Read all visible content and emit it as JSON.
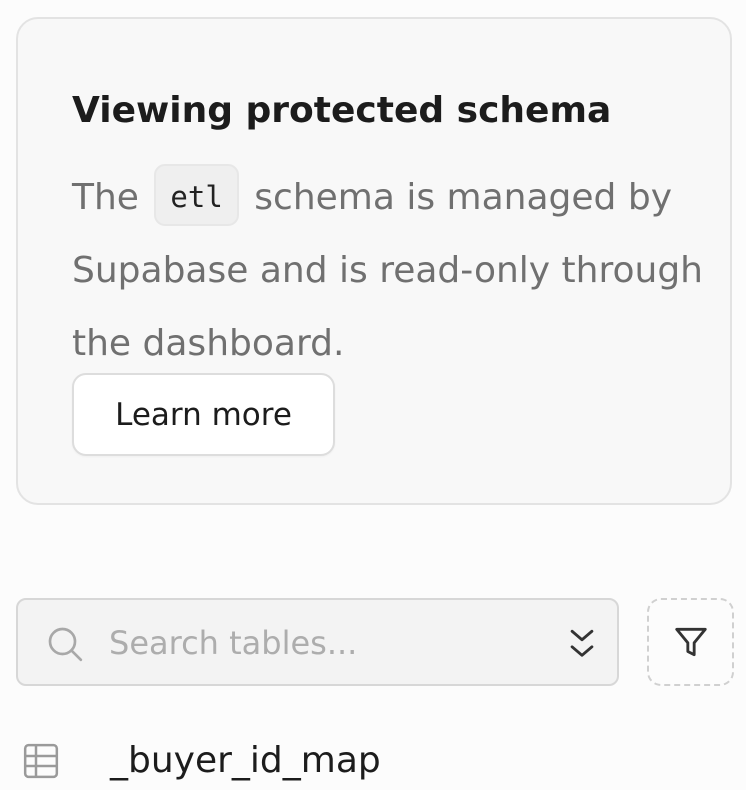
{
  "notice": {
    "title": "Viewing protected schema",
    "body_prefix": "The",
    "schema_name": "etl",
    "body_suffix": "schema is managed by Supabase and is read-only through the dashboard.",
    "button_label": "Learn more"
  },
  "search": {
    "placeholder": "Search tables...",
    "value": "",
    "leading_icon": "search-icon",
    "trailing_icon": "chevrons-up-down-icon"
  },
  "filter": {
    "icon": "filter-icon"
  },
  "tables": [
    {
      "name": "_buyer_id_map",
      "icon": "table-icon"
    }
  ]
}
